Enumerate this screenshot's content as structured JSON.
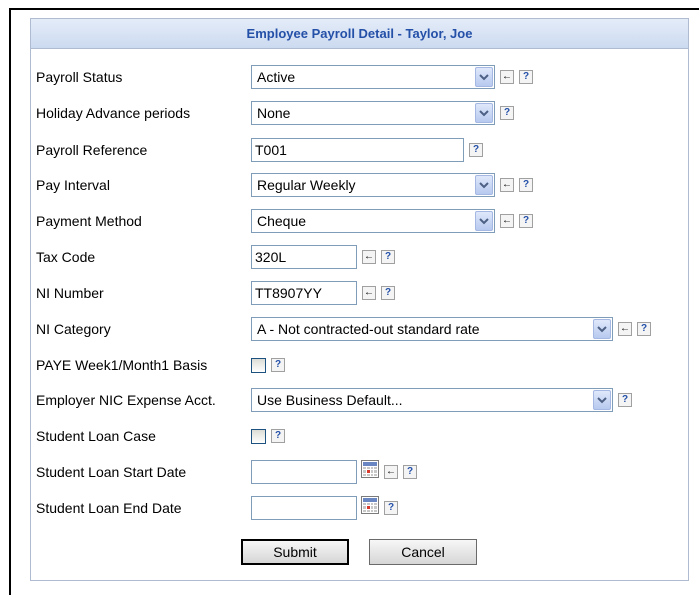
{
  "panel": {
    "title": "Employee Payroll Detail - Taylor, Joe"
  },
  "fields": {
    "payroll_status": {
      "label": "Payroll Status",
      "value": "Active"
    },
    "holiday_advance": {
      "label": "Holiday Advance periods",
      "value": "None"
    },
    "payroll_reference": {
      "label": "Payroll Reference",
      "value": "T001"
    },
    "pay_interval": {
      "label": "Pay Interval",
      "value": "Regular Weekly"
    },
    "payment_method": {
      "label": "Payment Method",
      "value": "Cheque"
    },
    "tax_code": {
      "label": "Tax Code",
      "value": "320L"
    },
    "ni_number": {
      "label": "NI Number",
      "value": "TT8907YY"
    },
    "ni_category": {
      "label": "NI Category",
      "value": "A - Not contracted-out standard rate"
    },
    "paye_basis": {
      "label": "PAYE Week1/Month1 Basis"
    },
    "employer_nic": {
      "label": "Employer NIC Expense Acct.",
      "value": "Use Business Default..."
    },
    "student_loan_case": {
      "label": "Student Loan Case"
    },
    "student_loan_start": {
      "label": "Student Loan Start Date",
      "value": ""
    },
    "student_loan_end": {
      "label": "Student Loan End Date",
      "value": ""
    }
  },
  "icons": {
    "help_glyph": "?",
    "back_glyph": "←",
    "dropdown_glyph": "⌄"
  },
  "buttons": {
    "submit": "Submit",
    "cancel": "Cancel"
  }
}
